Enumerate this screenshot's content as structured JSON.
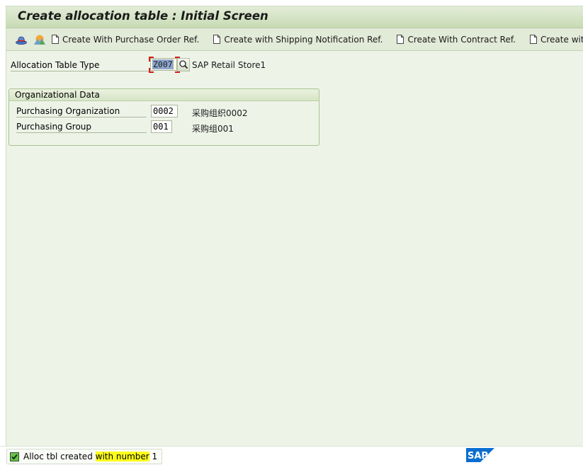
{
  "window": {
    "title": "Create allocation table : Initial Screen"
  },
  "toolbar": {
    "icons": [
      {
        "name": "hat-icon",
        "semantic": "hat-icon"
      },
      {
        "name": "mountain-icon",
        "semantic": "mountain-icon"
      }
    ],
    "buttons": [
      {
        "label": "Create With Purchase Order Ref.",
        "icon": "document-icon"
      },
      {
        "label": "Create with Shipping Notification Ref.",
        "icon": "document-icon"
      },
      {
        "label": "Create With Contract Ref.",
        "icon": "document-icon"
      },
      {
        "label": "Create with Mate",
        "icon": "document-icon"
      }
    ]
  },
  "header_fields": {
    "allocation_table_type": {
      "label": "Allocation Table Type",
      "value": "Z007",
      "description": "SAP Retail Store1"
    }
  },
  "org_data": {
    "title": "Organizational Data",
    "fields": [
      {
        "label": "Purchasing Organization",
        "value": "0002",
        "description": "采购组织0002"
      },
      {
        "label": "Purchasing Group",
        "value": "001",
        "description": "采购组001"
      }
    ]
  },
  "status": {
    "prefix": "Alloc tbl created ",
    "highlight": "with number",
    "suffix": " 1",
    "type": "success",
    "icon": "check-icon"
  },
  "branding": {
    "logo": "SAP",
    "logo_color": "#0a6ed1"
  }
}
